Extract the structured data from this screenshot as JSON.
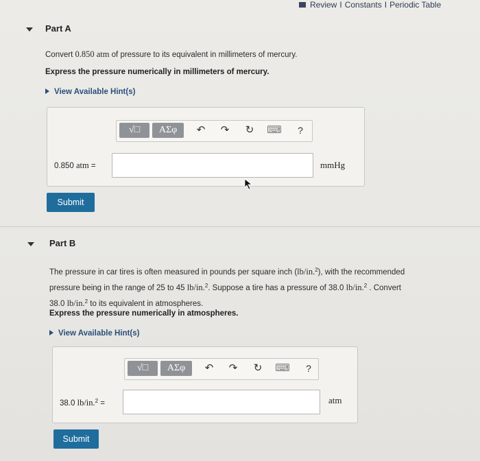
{
  "top_links": [
    "Review",
    "Constants",
    "Periodic Table"
  ],
  "separator": "I",
  "partA": {
    "title": "Part A",
    "question_before": "Convert ",
    "question_value": "0.850 atm",
    "question_after": " of pressure to its equivalent in millimeters of mercury.",
    "instruction": "Express the pressure numerically in millimeters of mercury.",
    "hint": "View Available Hint(s)",
    "answer_label_value": "0.850",
    "answer_label_unit": "atm",
    "answer_label_eq": " =",
    "answer_value": "",
    "unit": "mmHg",
    "submit": "Submit"
  },
  "partB": {
    "title": "Part B",
    "line1_a": "The pressure in car tires is often measured in pounds per square inch (",
    "line1_m": "lb/in.",
    "line1_b": "), with the recommended",
    "line2_a": "pressure being in the range of 25 to 45 ",
    "line2_m": "lb/in.",
    "line2_b": ". Suppose a tire has a pressure of 38.0 ",
    "line2_m2": "lb/in.",
    "line2_c": " . Convert",
    "line3_a": "38.0 ",
    "line3_m": "lb/in.",
    "line3_b": " to its equivalent in atmospheres.",
    "sup": "2",
    "instruction": "Express the pressure numerically in atmospheres.",
    "hint": "View Available Hint(s)",
    "answer_label_value": "38.0",
    "answer_label_unit": "lb/in.",
    "answer_label_eq": " =",
    "answer_value": "",
    "unit": "atm",
    "submit": "Submit"
  },
  "toolbar": {
    "templates_label": "√□",
    "symbols_label": "ΑΣφ",
    "undo": "↶",
    "redo": "↷",
    "reset": "↻",
    "keyboard": "⌨",
    "help": "?"
  },
  "icons": [
    "caret-down-icon",
    "undo-icon",
    "redo-icon",
    "reset-icon",
    "keyboard-icon",
    "help-icon",
    "mouse-cursor-icon"
  ],
  "colors": {
    "submit": "#1f6d9c",
    "hint": "#2a4e7a",
    "toolbar_dark": "#8f9297"
  }
}
